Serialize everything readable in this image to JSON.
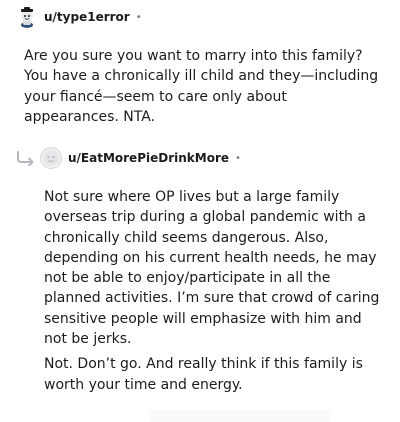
{
  "comments": [
    {
      "username": "u/type1error",
      "separator": "•",
      "avatar_icon": "snoo-avatar-icon",
      "paragraphs": [
        "Are you sure you want to marry into this family? You have a chronically ill child and they—including your fiancé—seem to care only about appearances. NTA."
      ]
    },
    {
      "username": "u/EatMorePieDrinkMore",
      "separator": "•",
      "avatar_icon": "default-avatar-icon",
      "reply_icon": "reply-arrow-icon",
      "paragraphs": [
        "Not sure where OP lives but a large family overseas trip during a global pandemic with a chronically child seems dangerous. Also, depending on his current health needs, he may not be able to enjoy/participate in all the planned activities. I’m sure that crowd of caring sensitive people will emphasize with him and not be jerks.",
        "Not. Don’t go. And really think if this family is worth your time and energy."
      ]
    }
  ]
}
